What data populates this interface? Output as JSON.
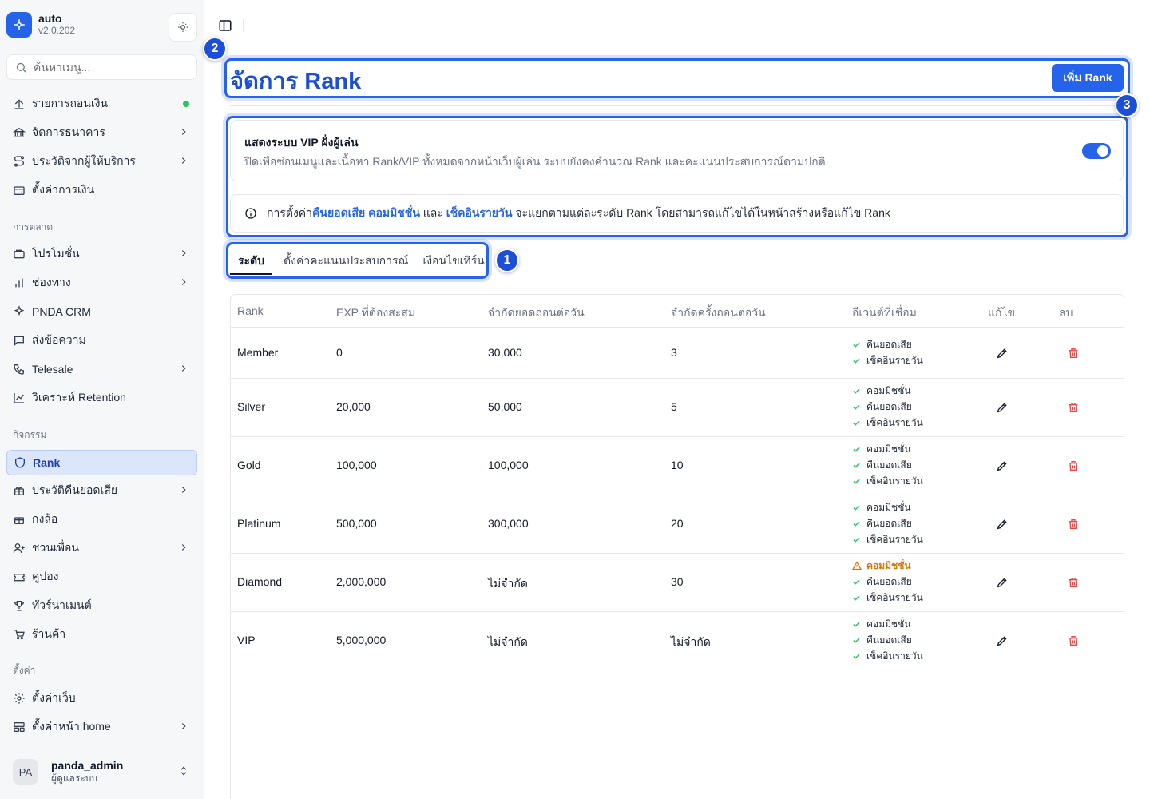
{
  "brand": {
    "name": "auto",
    "version": "v2.0.202"
  },
  "search": {
    "placeholder": "ค้นหาเมนู..."
  },
  "nav": {
    "withdraw": "รายการถอนเงิน",
    "bank": "จัดการธนาคาร",
    "provider_history": "ประวัติจากผู้ให้บริการ",
    "finance_settings": "ตั้งค่าการเงิน",
    "group_marketing": "การตลาด",
    "promotion": "โปรโมชั่น",
    "channel": "ช่องทาง",
    "crm": "PNDA CRM",
    "sms": "ส่งข้อความ",
    "telesale": "Telesale",
    "retention": "วิเคราะห์ Retention",
    "group_activity": "กิจกรรม",
    "rank": "Rank",
    "cashback_history": "ประวัติคืนยอดเสีย",
    "box": "กงล้อ",
    "invite": "ชวนเพื่อน",
    "coupon": "คูปอง",
    "tournament": "ทัวร์นาเมนต์",
    "shop": "ร้านค้า",
    "group_settings": "ตั้งค่า",
    "web_settings": "ตั้งค่าเว็บ",
    "home_settings": "ตั้งค่าหน้า home"
  },
  "user": {
    "initials": "PA",
    "name": "panda_admin",
    "role": "ผู้ดูแลระบบ"
  },
  "page": {
    "title": "จัดการ Rank",
    "add_button": "เพิ่ม Rank"
  },
  "vip": {
    "title": "แสดงระบบ VIP ฝั่งผู้เล่น",
    "description": "ปิดเพื่อซ่อนเมนูและเนื้อหา Rank/VIP ทั้งหมดจากหน้าเว็บผู้เล่น ระบบยังคงคำนวณ Rank และคะแนนประสบการณ์ตามปกติ",
    "enabled": true
  },
  "info": {
    "prefix": "การตั้งค่า",
    "link1": "คืนยอดเสีย",
    "link2": "คอมมิชชั่น",
    "mid": " และ ",
    "link3": "เช็คอินรายวัน",
    "suffix": " จะแยกตามแต่ละระดับ Rank โดยสามารถแก้ไขได้ในหน้าสร้างหรือแก้ไข Rank"
  },
  "tabs": [
    "ระดับ",
    "ตั้งค่าคะแนนประสบการณ์",
    "เงื่อนไขเทิร์น"
  ],
  "annotations": [
    "1",
    "2",
    "3"
  ],
  "table": {
    "headers": [
      "Rank",
      "EXP ที่ต้องสะสม",
      "จำกัดยอดถอนต่อวัน",
      "จำกัดครั้งถอนต่อวัน",
      "อีเวนต์ที่เชื่อม",
      "แก้ไข",
      "ลบ"
    ],
    "rows": [
      {
        "rank": "Member",
        "exp": "0",
        "limit_amount": "30,000",
        "limit_count": "3",
        "events": [
          "คืนยอดเสีย",
          "เช็คอินรายวัน"
        ]
      },
      {
        "rank": "Silver",
        "exp": "20,000",
        "limit_amount": "50,000",
        "limit_count": "5",
        "events": [
          "คอมมิชชั่น",
          "คืนยอดเสีย",
          "เช็คอินรายวัน"
        ]
      },
      {
        "rank": "Gold",
        "exp": "100,000",
        "limit_amount": "100,000",
        "limit_count": "10",
        "events": [
          "คอมมิชชั่น",
          "คืนยอดเสีย",
          "เช็คอินรายวัน"
        ]
      },
      {
        "rank": "Platinum",
        "exp": "500,000",
        "limit_amount": "300,000",
        "limit_count": "20",
        "events": [
          "คอมมิชชั่น",
          "คืนยอดเสีย",
          "เช็คอินรายวัน"
        ]
      },
      {
        "rank": "Diamond",
        "exp": "2,000,000",
        "limit_amount": "ไม่จำกัด",
        "limit_count": "30",
        "events": [
          "คอมมิชชั่น",
          "คืนยอดเสีย",
          "เช็คอินรายวัน"
        ],
        "warn_event": 0
      },
      {
        "rank": "VIP",
        "exp": "5,000,000",
        "limit_amount": "ไม่จำกัด",
        "limit_count": "ไม่จำกัด",
        "events": [
          "คอมมิชชั่น",
          "คืนยอดเสีย",
          "เช็คอินรายวัน"
        ]
      }
    ]
  },
  "colors": {
    "accent": "#2563eb",
    "active_bg": "#dbe6fb",
    "danger": "#ef4444",
    "warning": "#d97706",
    "success": "#22c55e"
  }
}
